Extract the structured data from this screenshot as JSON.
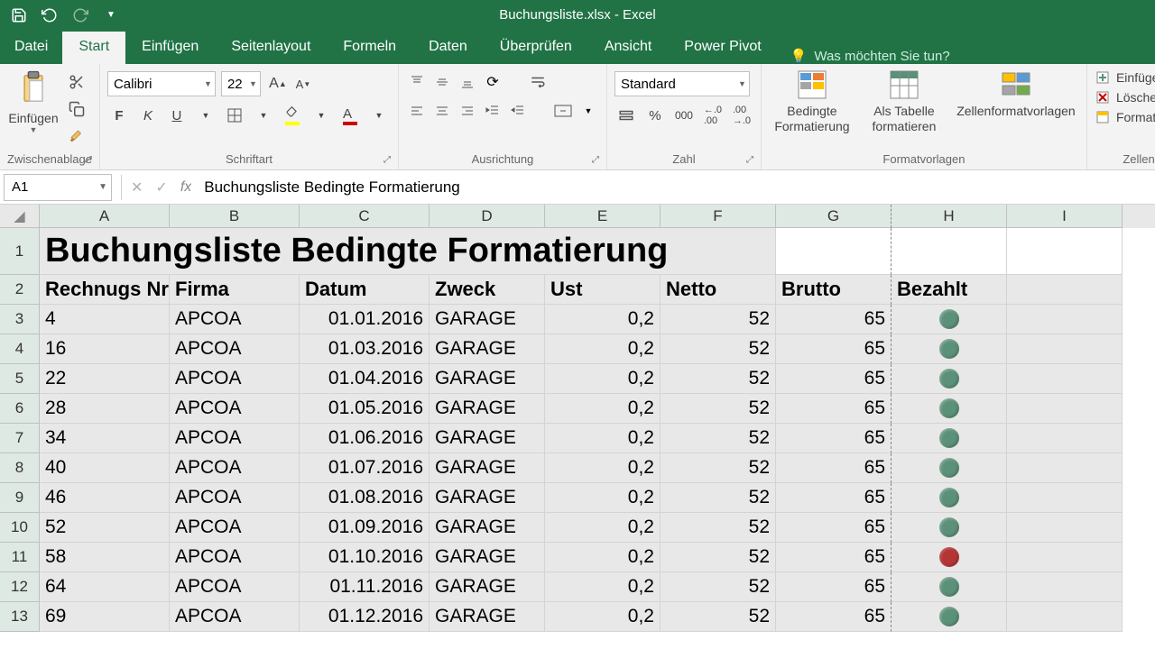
{
  "title": "Buchungsliste.xlsx - Excel",
  "tabs": {
    "file": "Datei",
    "start": "Start",
    "einfuegen": "Einfügen",
    "seitenlayout": "Seitenlayout",
    "formeln": "Formeln",
    "daten": "Daten",
    "ueberpruefen": "Überprüfen",
    "ansicht": "Ansicht",
    "powerpivot": "Power Pivot"
  },
  "tell_me": "Was möchten Sie tun?",
  "ribbon": {
    "clipboard": {
      "paste": "Einfügen",
      "label": "Zwischenablage"
    },
    "font": {
      "name": "Calibri",
      "size": "22",
      "label": "Schriftart"
    },
    "alignment": {
      "label": "Ausrichtung"
    },
    "number": {
      "format": "Standard",
      "label": "Zahl"
    },
    "styles": {
      "cond": "Bedingte\nFormatierung",
      "table": "Als Tabelle\nformatieren",
      "cell": "Zellenformatvorlagen",
      "label": "Formatvorlagen"
    },
    "cells": {
      "insert": "Einfügen",
      "delete": "Löschen",
      "format": "Format",
      "label": "Zellen"
    }
  },
  "name_box": "A1",
  "formula": "Buchungsliste Bedingte Formatierung",
  "columns": [
    "A",
    "B",
    "C",
    "D",
    "E",
    "F",
    "G",
    "H",
    "I"
  ],
  "sheet": {
    "title": "Buchungsliste Bedingte Formatierung",
    "headers": {
      "a": "Rechnugs Nr.",
      "b": "Firma",
      "c": "Datum",
      "d": "Zweck",
      "e": "Ust",
      "f": "Netto",
      "g": "Brutto",
      "h": "Bezahlt"
    },
    "rows": [
      {
        "n": "3",
        "a": "4",
        "b": "APCOA",
        "c": "01.01.2016",
        "d": "GARAGE",
        "e": "0,2",
        "f": "52",
        "g": "65",
        "h": "green"
      },
      {
        "n": "4",
        "a": "16",
        "b": "APCOA",
        "c": "01.03.2016",
        "d": "GARAGE",
        "e": "0,2",
        "f": "52",
        "g": "65",
        "h": "green"
      },
      {
        "n": "5",
        "a": "22",
        "b": "APCOA",
        "c": "01.04.2016",
        "d": "GARAGE",
        "e": "0,2",
        "f": "52",
        "g": "65",
        "h": "green"
      },
      {
        "n": "6",
        "a": "28",
        "b": "APCOA",
        "c": "01.05.2016",
        "d": "GARAGE",
        "e": "0,2",
        "f": "52",
        "g": "65",
        "h": "green"
      },
      {
        "n": "7",
        "a": "34",
        "b": "APCOA",
        "c": "01.06.2016",
        "d": "GARAGE",
        "e": "0,2",
        "f": "52",
        "g": "65",
        "h": "green"
      },
      {
        "n": "8",
        "a": "40",
        "b": "APCOA",
        "c": "01.07.2016",
        "d": "GARAGE",
        "e": "0,2",
        "f": "52",
        "g": "65",
        "h": "green"
      },
      {
        "n": "9",
        "a": "46",
        "b": "APCOA",
        "c": "01.08.2016",
        "d": "GARAGE",
        "e": "0,2",
        "f": "52",
        "g": "65",
        "h": "green"
      },
      {
        "n": "10",
        "a": "52",
        "b": "APCOA",
        "c": "01.09.2016",
        "d": "GARAGE",
        "e": "0,2",
        "f": "52",
        "g": "65",
        "h": "green"
      },
      {
        "n": "11",
        "a": "58",
        "b": "APCOA",
        "c": "01.10.2016",
        "d": "GARAGE",
        "e": "0,2",
        "f": "52",
        "g": "65",
        "h": "red"
      },
      {
        "n": "12",
        "a": "64",
        "b": "APCOA",
        "c": "01.11.2016",
        "d": "GARAGE",
        "e": "0,2",
        "f": "52",
        "g": "65",
        "h": "green"
      },
      {
        "n": "13",
        "a": "69",
        "b": "APCOA",
        "c": "01.12.2016",
        "d": "GARAGE",
        "e": "0,2",
        "f": "52",
        "g": "65",
        "h": "green"
      }
    ]
  }
}
